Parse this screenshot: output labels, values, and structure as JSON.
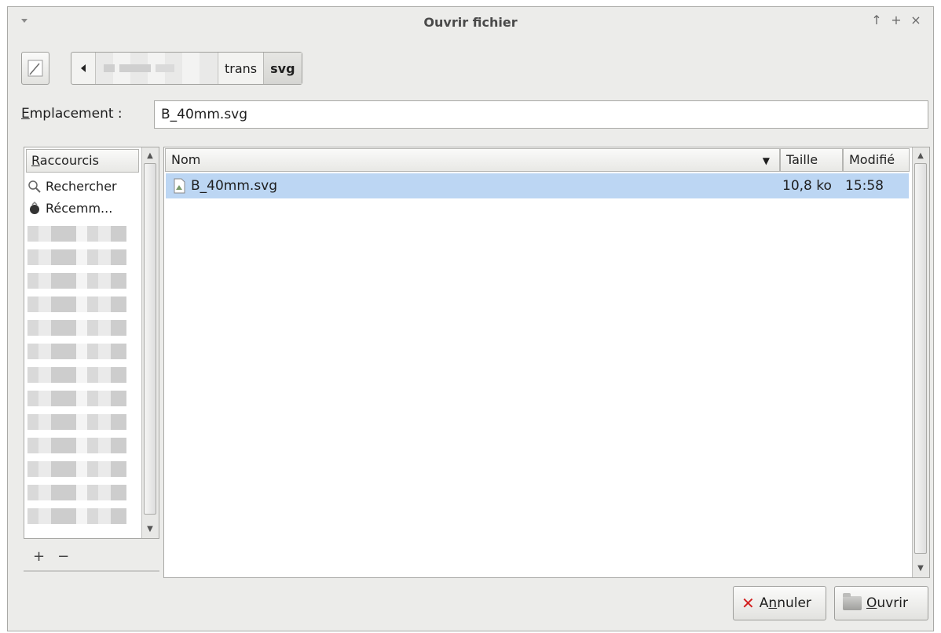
{
  "window": {
    "title": "Ouvrir fichier",
    "controls": [
      "↑",
      "+",
      "×"
    ]
  },
  "pathbar": {
    "segments": [
      {
        "label": "trans",
        "active": false
      },
      {
        "label": "svg",
        "active": true
      }
    ]
  },
  "location": {
    "label_prefix": "E",
    "label_rest": "mplacement :",
    "value": "B_40mm.svg"
  },
  "shortcuts": {
    "header_prefix": "R",
    "header_rest": "accourcis",
    "items": [
      {
        "label": "Rechercher",
        "icon": "search-icon"
      },
      {
        "label": "Récemm...",
        "icon": "recent-icon"
      }
    ],
    "add_label": "+",
    "remove_label": "−"
  },
  "filelist": {
    "columns": {
      "name": "Nom",
      "size": "Taille",
      "modified": "Modifié"
    },
    "rows": [
      {
        "name": "B_40mm.svg",
        "size": "10,8 ko",
        "modified": "15:58",
        "icon": "svg-file-icon",
        "selected": true
      }
    ]
  },
  "buttons": {
    "cancel_prefix": "A",
    "cancel_u": "n",
    "cancel_rest": "nuler",
    "open_u": "O",
    "open_rest": "uvrir"
  }
}
